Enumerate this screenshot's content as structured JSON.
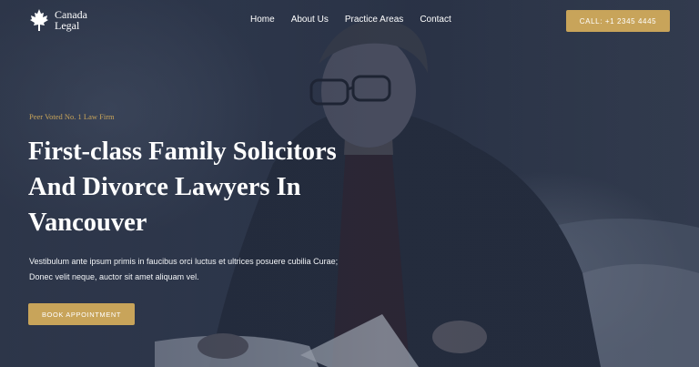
{
  "brand": {
    "name_line1": "Canada",
    "name_line2": "Legal",
    "icon": "maple-leaf-icon"
  },
  "nav": {
    "items": [
      {
        "label": "Home"
      },
      {
        "label": "About Us"
      },
      {
        "label": "Practice Areas"
      },
      {
        "label": "Contact"
      }
    ]
  },
  "header": {
    "call_label": "CALL: +1 2345 4445"
  },
  "hero": {
    "eyebrow": "Peer Voted No. 1 Law Firm",
    "headline_lines": [
      "First-class Family Solicitors",
      "And Divorce Lawyers In",
      "Vancouver"
    ],
    "description_lines": [
      "Vestibulum ante ipsum primis in faucibus orci luctus et ultrices posuere cubilia Curae;",
      "Donec velit neque, auctor sit amet aliquam vel."
    ],
    "cta_label": "BOOK APPOINTMENT"
  },
  "colors": {
    "accent": "#c8a45a",
    "overlay": "#2a3346",
    "text": "#ffffff"
  }
}
